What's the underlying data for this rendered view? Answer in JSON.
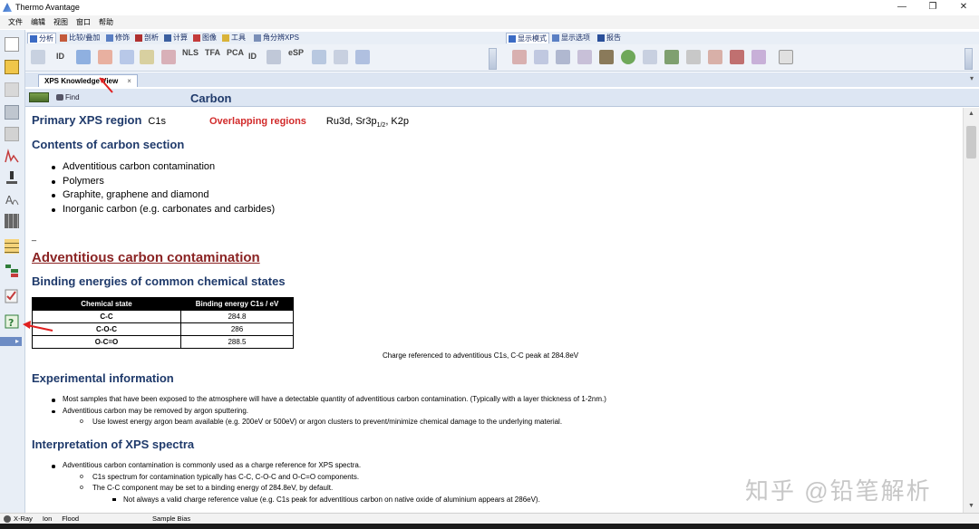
{
  "window": {
    "title": "Thermo Avantage",
    "controls": [
      "—",
      "❐",
      "✕"
    ]
  },
  "menu": [
    "文件",
    "编辑",
    "视图",
    "窗口",
    "帮助"
  ],
  "ribbon_tabs": [
    {
      "label": "分析",
      "icon": "analysis-icon",
      "active": true
    },
    {
      "label": "比较/叠加",
      "icon": "compare-icon"
    },
    {
      "label": "修饰",
      "icon": "modify-icon"
    },
    {
      "label": "剖析",
      "icon": "profile-icon"
    },
    {
      "label": "计算",
      "icon": "calc-icon"
    },
    {
      "label": "图像",
      "icon": "image-icon"
    },
    {
      "label": "工具",
      "icon": "tools-icon"
    },
    {
      "label": "角分辨XPS",
      "icon": "arxps-icon"
    },
    {
      "label": "显示模式",
      "icon": "display-mode-icon",
      "active": true
    },
    {
      "label": "显示选项",
      "icon": "display-options-icon"
    },
    {
      "label": "报告",
      "icon": "report-icon"
    }
  ],
  "toolbar_text_buttons": [
    "ID",
    "NLS",
    "TFA",
    "PCA",
    "ID",
    "eSP"
  ],
  "document_tab": {
    "label": "XPS Knowledge View",
    "close": "×"
  },
  "panel": {
    "find_label": "Find",
    "title": "Carbon"
  },
  "primary": {
    "heading": "Primary XPS region",
    "value": "C1s",
    "overlap_label": "Overlapping regions",
    "overlap_value": "Ru3d, Sr3p",
    "overlap_sub": "1/2",
    "overlap_tail": ", K2p"
  },
  "contents": {
    "heading": "Contents of carbon section",
    "items": [
      "Adventitious carbon contamination",
      "Polymers",
      "Graphite, graphene and diamond",
      "Inorganic carbon (e.g. carbonates and carbides)"
    ]
  },
  "dash": "_",
  "adventitious_heading": "Adventitious carbon contamination",
  "binding": {
    "heading": "Binding energies of common chemical states",
    "columns": [
      "Chemical state",
      "Binding energy C1s / eV"
    ],
    "rows": [
      [
        "C-C",
        "284.8"
      ],
      [
        "C-O-C",
        "286"
      ],
      [
        "O-C=O",
        "288.5"
      ]
    ],
    "caption": "Charge referenced to adventitious C1s, C-C peak at 284.8eV"
  },
  "experimental": {
    "heading": "Experimental information",
    "items": [
      "Most samples that have been exposed to the atmosphere will have a detectable quantity of adventitious carbon contamination.  (Typically with a layer thickness of 1-2nm.)",
      "Adventitious carbon may be removed by argon sputtering.",
      "Use lowest energy argon beam available (e.g. 200eV or 500eV) or argon clusters to prevent/minimize chemical damage to the underlying material."
    ]
  },
  "interpretation": {
    "heading": "Interpretation of XPS spectra",
    "items": [
      "Adventitious carbon contamination is commonly used as a charge reference for XPS spectra.",
      "C1s spectrum for contamination typically has C-C, C-O-C and O-C=O components.",
      "The C-C component may be set to a binding energy of 284.8eV, by default.",
      "Not always a valid charge reference value (e.g. C1s peak for adventitious carbon on native oxide of aluminium appears at 286eV)."
    ]
  },
  "watermark": "知乎 @铅笔解析",
  "status": [
    "X-Ray",
    "Ion",
    "Flood",
    "Sample Bias"
  ],
  "colors": {
    "heading": "#1f3a6b",
    "overlap": "#d22b2b",
    "adventitious": "#8a2323",
    "arrow": "#e02020"
  }
}
